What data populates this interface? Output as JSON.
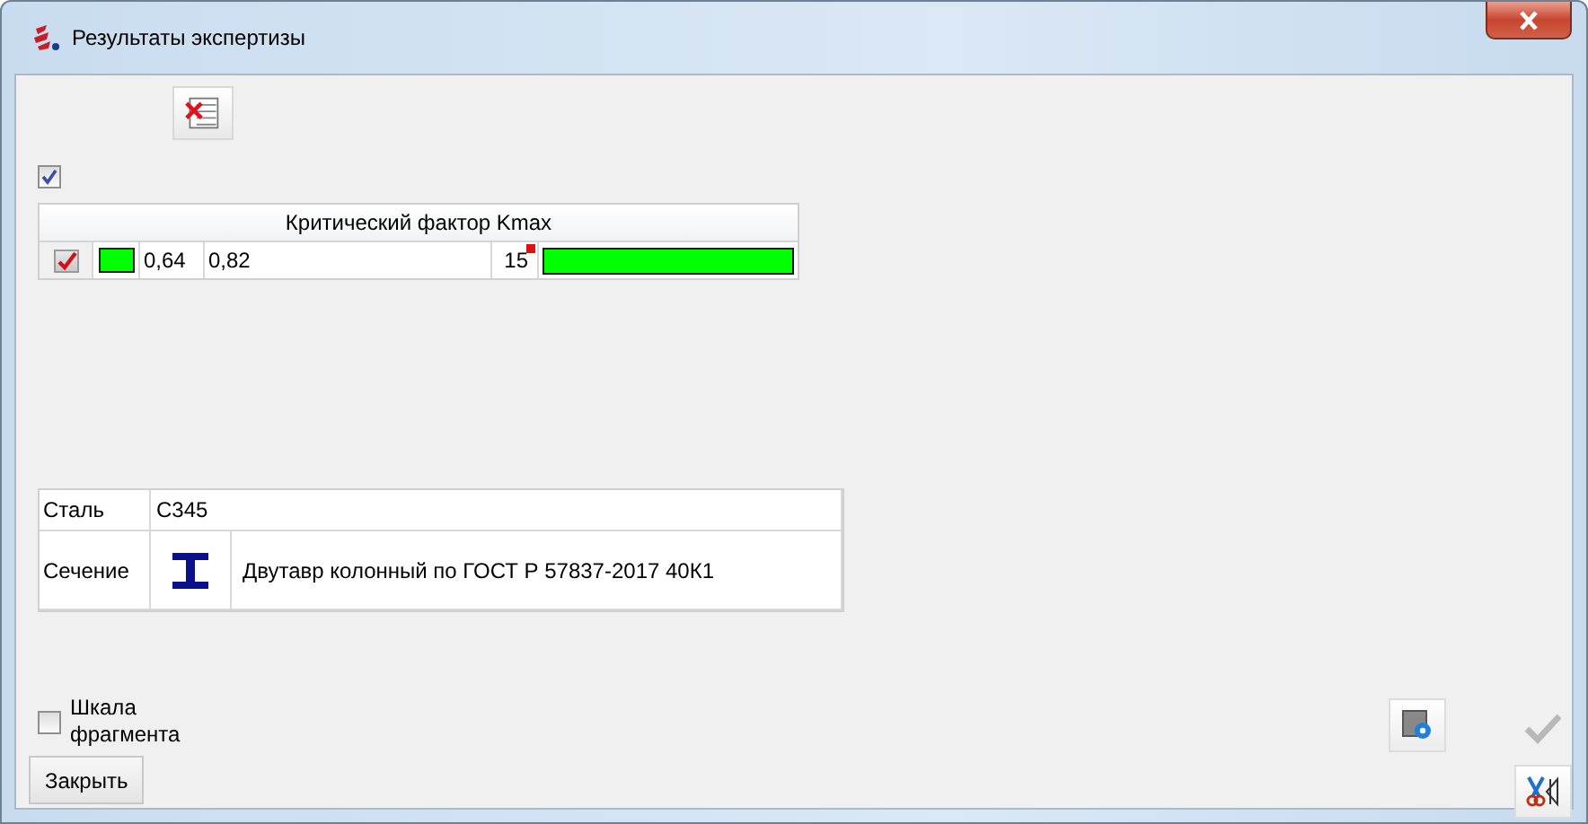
{
  "window": {
    "title": "Результаты экспертизы"
  },
  "show_checkbox": {
    "checked": true
  },
  "factor_table": {
    "header": "Критический фактор Kmax",
    "rows": [
      {
        "checked": true,
        "color": "#00ff00",
        "value_1": "0,64",
        "value_2": "0,82",
        "count": "15",
        "flagged": true,
        "level": 1
      }
    ]
  },
  "properties": [
    {
      "kind": "text",
      "label": "Сталь",
      "value": "С345"
    },
    {
      "kind": "section",
      "label": "Сечение",
      "value": "Двутавр колонный по ГОСТ Р 57837-2017 40К1"
    }
  ],
  "scale_checkbox": {
    "label": "Шкала фрагмента",
    "checked": false
  },
  "close_button": "Закрыть",
  "apply_button": {
    "disabled": true
  }
}
